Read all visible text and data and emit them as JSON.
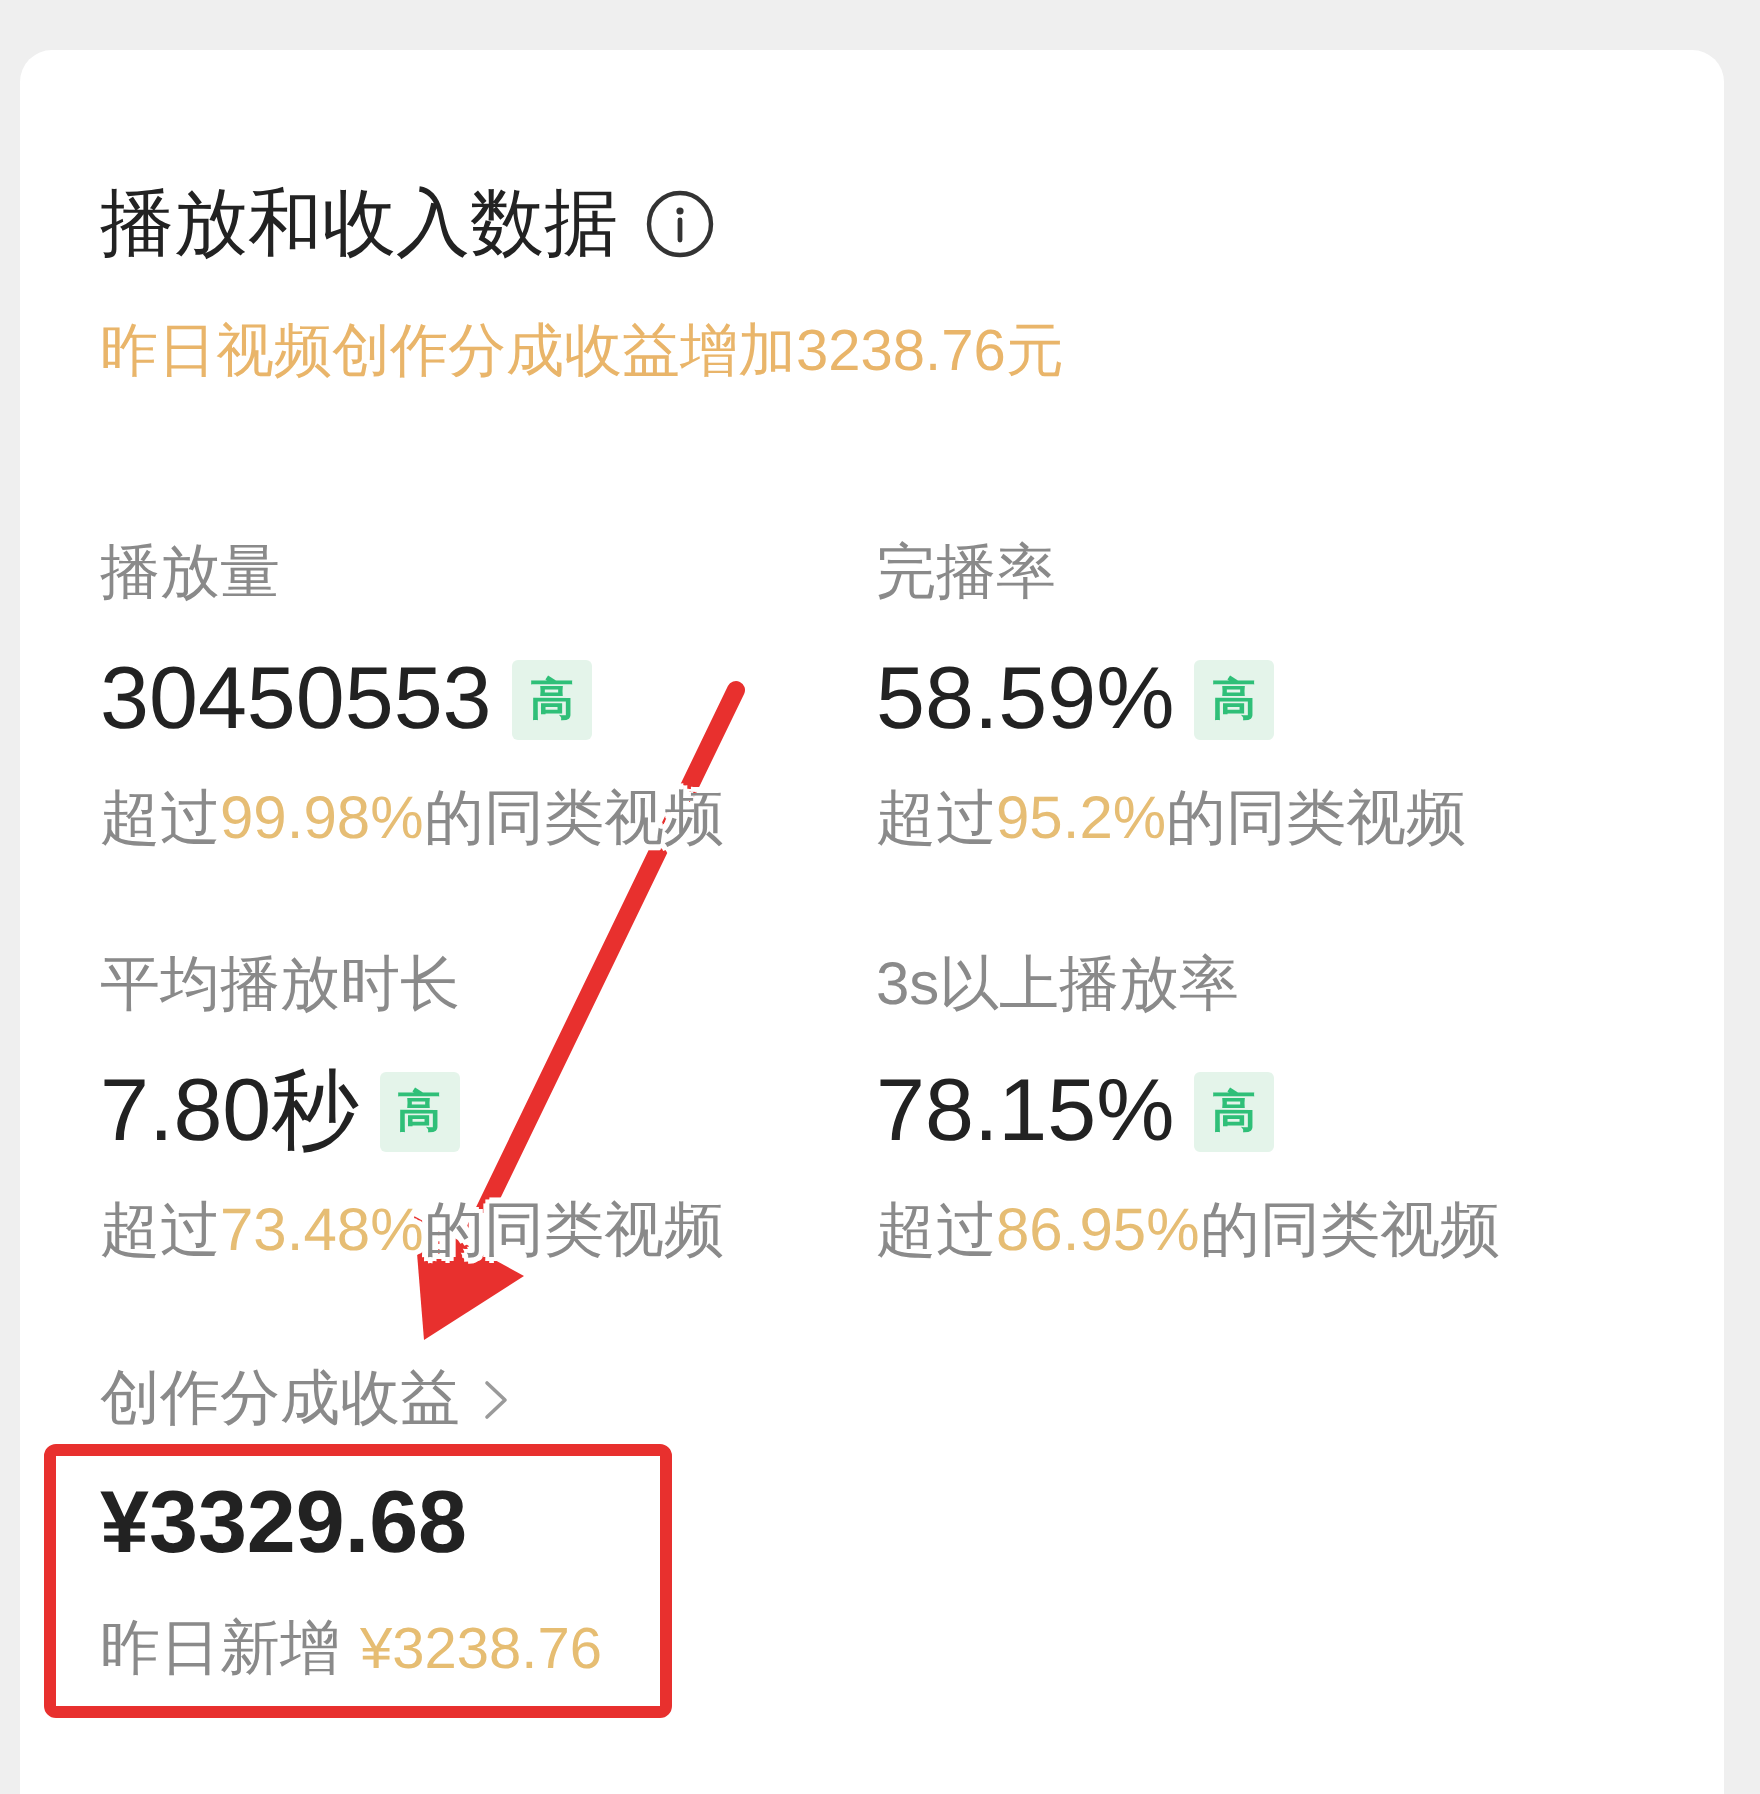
{
  "card": {
    "title": "播放和收入数据",
    "notice": "昨日视频创作分成收益增加3238.76元"
  },
  "metrics": [
    {
      "label": "播放量",
      "value": "30450553",
      "badge": "高",
      "comparison": {
        "before": "超过",
        "highlight": "99.98%",
        "after": "的同类视频"
      }
    },
    {
      "label": "完播率",
      "value": "58.59%",
      "badge": "高",
      "comparison": {
        "before": "超过",
        "highlight": "95.2%",
        "after": "的同类视频"
      }
    },
    {
      "label": "平均播放时长",
      "value": "7.80秒",
      "badge": "高",
      "comparison": {
        "before": "超过",
        "highlight": "73.48%",
        "after": "的同类视频"
      }
    },
    {
      "label": "3s以上播放率",
      "value": "78.15%",
      "badge": "高",
      "comparison": {
        "before": "超过",
        "highlight": "86.95%",
        "after": "的同类视频"
      }
    }
  ],
  "earnings": {
    "label": "创作分成收益",
    "amount": "¥3329.68",
    "yesterday_label": "昨日新增",
    "yesterday_amount": "¥3238.76"
  }
}
